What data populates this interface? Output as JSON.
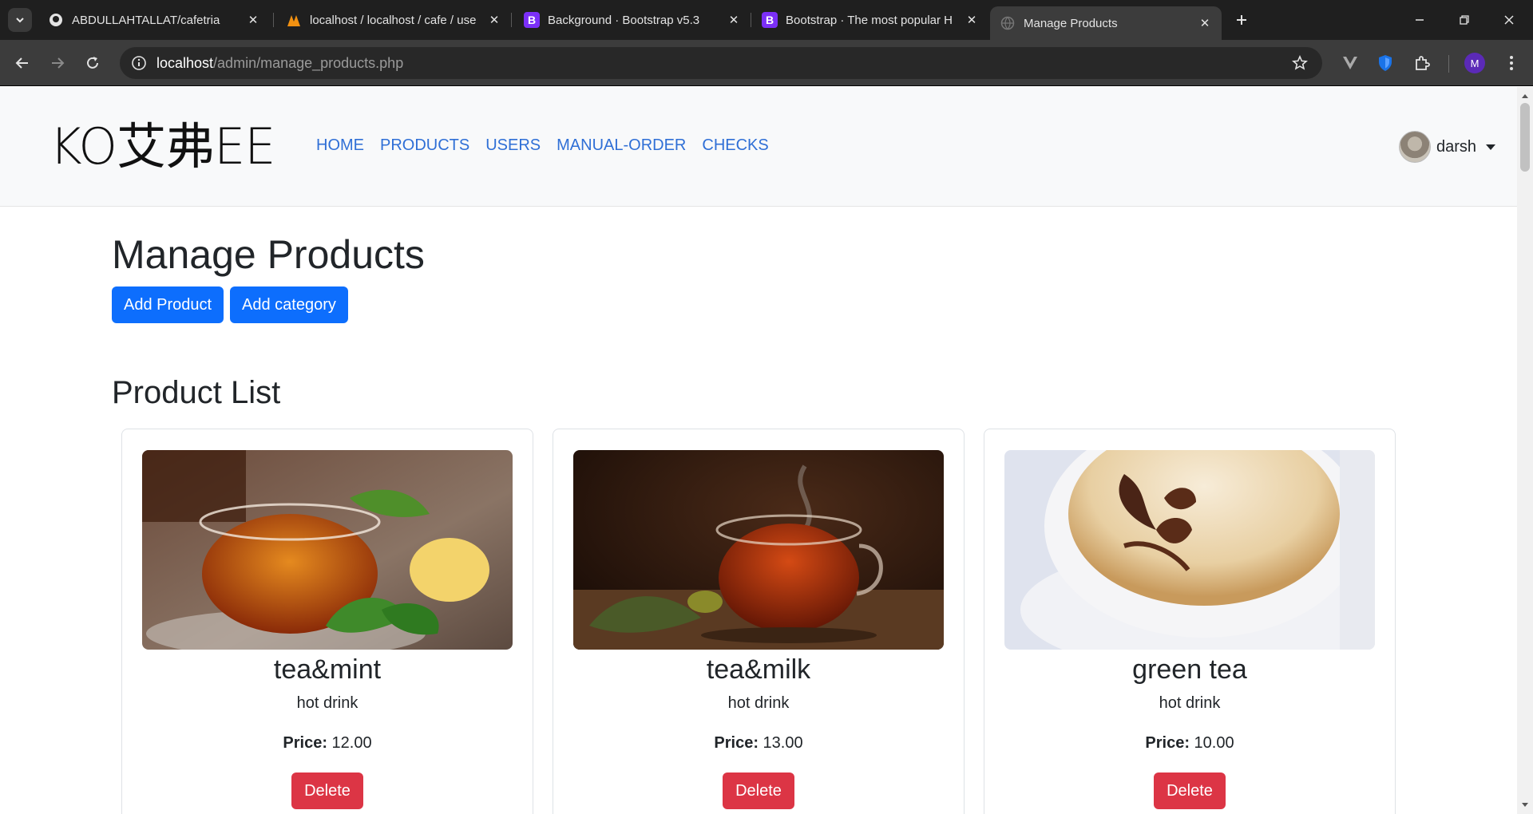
{
  "browser": {
    "tabs": [
      {
        "title": "ABDULLAHTALLAT/cafetria",
        "icon": "github-icon",
        "active": false
      },
      {
        "title": "localhost / localhost / cafe / use",
        "icon": "phpmyadmin-icon",
        "active": false
      },
      {
        "title": "Background · Bootstrap v5.3",
        "icon": "bootstrap-icon",
        "active": false
      },
      {
        "title": "Bootstrap · The most popular H",
        "icon": "bootstrap-icon",
        "active": false
      },
      {
        "title": "Manage Products",
        "icon": "globe-icon",
        "active": true
      }
    ],
    "url_host": "localhost",
    "url_path": "/admin/manage_products.php",
    "profile_initial": "M"
  },
  "site": {
    "brand": "KO艾弗EE",
    "nav": [
      "HOME",
      "PRODUCTS",
      "USERS",
      "MANUAL-ORDER",
      "CHECKS"
    ],
    "user_name": "darsh"
  },
  "page": {
    "title": "Manage Products",
    "add_product_label": "Add Product",
    "add_category_label": "Add category",
    "section_title": "Product List"
  },
  "products": [
    {
      "name": "tea&mint",
      "category": "hot drink",
      "price_label": "Price:",
      "price": "12.00",
      "delete_label": "Delete"
    },
    {
      "name": "tea&milk",
      "category": "hot drink",
      "price_label": "Price:",
      "price": "13.00",
      "delete_label": "Delete"
    },
    {
      "name": "green tea",
      "category": "hot drink",
      "price_label": "Price:",
      "price": "10.00",
      "delete_label": "Delete"
    }
  ],
  "colors": {
    "primary": "#0d6efd",
    "danger": "#dc3545",
    "nav_link": "#2f6fd6",
    "navbar_bg": "#f8f9fa"
  }
}
